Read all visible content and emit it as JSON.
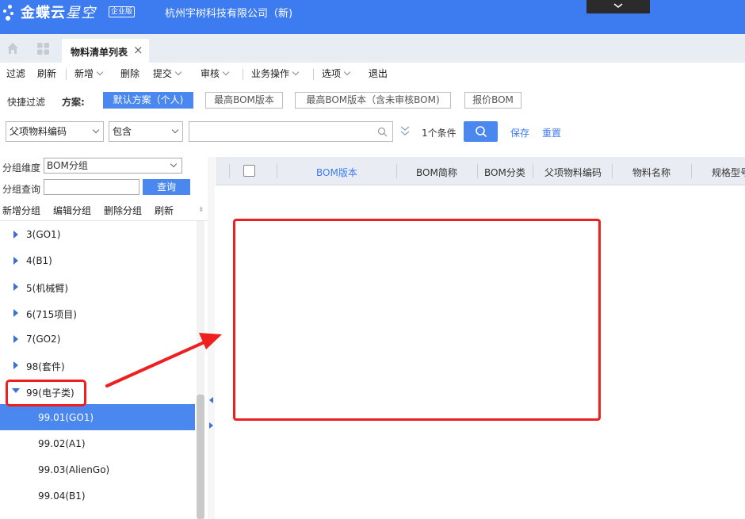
{
  "app": {
    "brand": "金蝶云",
    "brand_sub": "星空",
    "edition": "企业版",
    "company": "杭州宇树科技有限公司（新)"
  },
  "tabs": [
    {
      "label": "物料清单列表",
      "active": true
    }
  ],
  "toolbar": {
    "items": [
      {
        "label": "过滤",
        "dropdown": false
      },
      {
        "label": "刷新",
        "dropdown": false
      },
      {
        "label": "新增",
        "dropdown": true
      },
      {
        "label": "删除",
        "dropdown": false
      },
      {
        "label": "提交",
        "dropdown": true
      },
      {
        "label": "审核",
        "dropdown": true
      },
      {
        "label": "业务操作",
        "dropdown": true
      },
      {
        "label": "选项",
        "dropdown": true
      },
      {
        "label": "退出",
        "dropdown": false
      }
    ]
  },
  "quick_filter": {
    "label": "快捷过滤",
    "scheme_label": "方案:",
    "schemes": [
      {
        "label": "默认方案（个人)",
        "active": true
      },
      {
        "label": "最高BOM版本",
        "active": false
      },
      {
        "label": "最高BOM版本（含未审核BOM)",
        "active": false
      },
      {
        "label": "报价BOM",
        "active": false
      }
    ]
  },
  "search": {
    "field": "父项物料编码",
    "operator": "包含",
    "value": "",
    "condition_count": "1个条件",
    "save_label": "保存",
    "reset_label": "重置"
  },
  "group_panel": {
    "dimension_label": "分组维度",
    "dimension_value": "BOM分组",
    "query_label": "分组查询",
    "query_value": "",
    "query_button": "查询",
    "actions": [
      "新增分组",
      "编辑分组",
      "删除分组",
      "刷新"
    ],
    "sort_mark": "⇟",
    "tree": [
      {
        "label": "3(GO1)",
        "level": 0,
        "state": "collapsed"
      },
      {
        "label": "4(B1)",
        "level": 0,
        "state": "collapsed"
      },
      {
        "label": "5(机械臂)",
        "level": 0,
        "state": "collapsed"
      },
      {
        "label": "6(715项目)",
        "level": 0,
        "state": "collapsed"
      },
      {
        "label": "7(GO2)",
        "level": 0,
        "state": "collapsed"
      },
      {
        "label": "98(套件)",
        "level": 0,
        "state": "collapsed"
      },
      {
        "label": "99(电子类)",
        "level": 0,
        "state": "expanded"
      },
      {
        "label": "99.01(GO1)",
        "level": 1,
        "selected": true
      },
      {
        "label": "99.02(A1)",
        "level": 1
      },
      {
        "label": "99.03(AlienGo)",
        "level": 1
      },
      {
        "label": "99.04(B1)",
        "level": 1
      }
    ]
  },
  "grid": {
    "columns": [
      {
        "label": "BOM版本",
        "active": true
      },
      {
        "label": "BOM简称"
      },
      {
        "label": "BOM分类"
      },
      {
        "label": "父项物料编码"
      },
      {
        "label": "物料名称"
      },
      {
        "label": "规格型号"
      }
    ],
    "rows": []
  },
  "annotation": {
    "color": "#ee1f1f"
  }
}
